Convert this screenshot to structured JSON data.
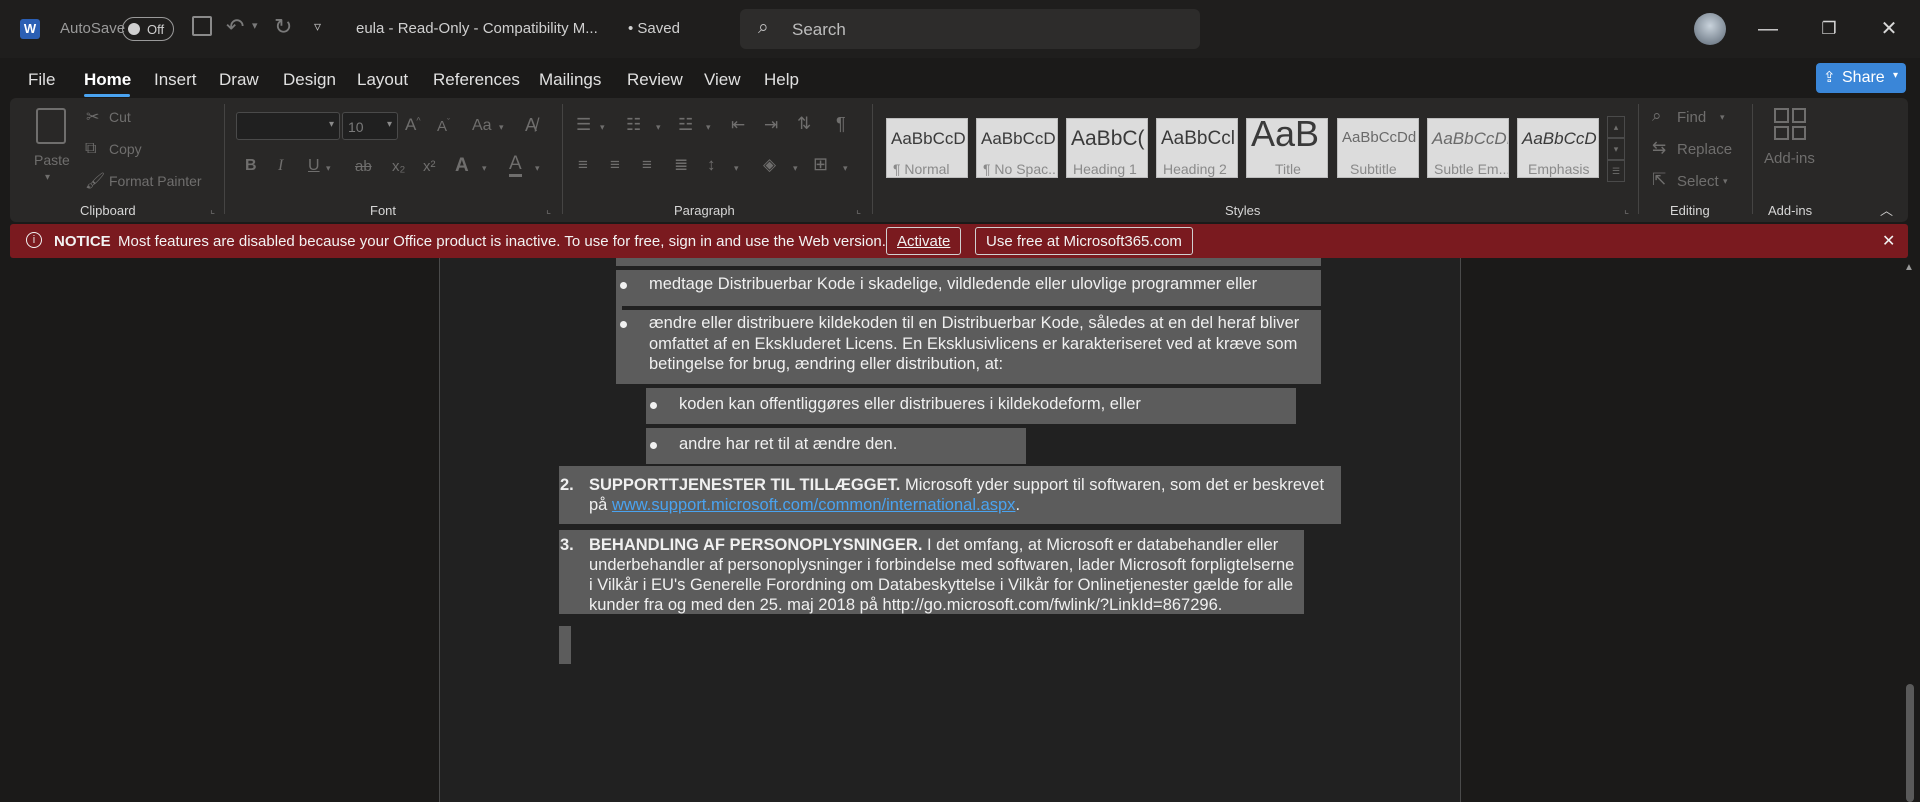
{
  "titlebar": {
    "autosave_label": "AutoSave",
    "autosave_state": "Off",
    "doc_title": "eula  -  Read-Only  -  Compatibility M...",
    "save_status": "• Saved",
    "search_placeholder": "Search"
  },
  "menu": [
    "File",
    "Home",
    "Insert",
    "Draw",
    "Design",
    "Layout",
    "References",
    "Mailings",
    "Review",
    "View",
    "Help"
  ],
  "share_label": "Share",
  "ribbon": {
    "clipboard": {
      "paste": "Paste",
      "cut": "Cut",
      "copy": "Copy",
      "format_painter": "Format Painter",
      "label": "Clipboard"
    },
    "font": {
      "size": "10",
      "label": "Font",
      "bold": "B",
      "italic": "I",
      "underline": "U",
      "strike": "ab",
      "sub": "x₂",
      "sup": "x²",
      "aa": "Aa"
    },
    "paragraph_label": "Paragraph",
    "styles": [
      {
        "preview": "AaBbCcD",
        "name": "¶ Normal"
      },
      {
        "preview": "AaBbCcD",
        "name": "¶ No Spac..."
      },
      {
        "preview": "AaBbC(",
        "name": "Heading 1"
      },
      {
        "preview": "AaBbCcl",
        "name": "Heading 2"
      },
      {
        "preview": "AaB",
        "name": "Title"
      },
      {
        "preview": "AaBbCcDd",
        "name": "Subtitle"
      },
      {
        "preview": "AaBbCcDı",
        "name": "Subtle Em..."
      },
      {
        "preview": "AaBbCcD",
        "name": "Emphasis"
      }
    ],
    "styles_label": "Styles",
    "editing": {
      "find": "Find",
      "replace": "Replace",
      "select": "Select",
      "label": "Editing"
    },
    "addins": {
      "button": "Add-ins",
      "label": "Add-ins"
    }
  },
  "notice": {
    "title": "NOTICE",
    "message": "Most features are disabled because your Office product is inactive. To use for free, sign in and use the Web version.",
    "activate": "Activate",
    "use_free": "Use free at Microsoft365.com"
  },
  "document": {
    "bullet1": "medtage Distribuerbar Kode i skadelige, vildledende eller ulovlige programmer eller",
    "bullet2_l1": "ændre eller distribuere kildekoden til en Distribuerbar Kode, således at en del heraf bliver",
    "bullet2_l2": "omfattet af en Ekskluderet Licens. En Eksklusivlicens er karakteriseret ved at kræve som",
    "bullet2_l3": "betingelse for brug, ændring eller distribution, at:",
    "sub1": "koden kan offentliggøres eller distribueres i kildekodeform, eller",
    "sub2": "andre har ret til at ændre den.",
    "item2_num": "2.",
    "item2_head": "SUPPORTTJENESTER TIL TILLÆGGET.",
    "item2_l1_rest": " Microsoft yder support til softwaren, som det er beskrevet",
    "item2_l2_pre": "på ",
    "item2_link": "www.support.microsoft.com/common/international.aspx",
    "item2_l2_post": ".",
    "item3_num": "3.",
    "item3_head": "BEHANDLING AF PERSONOPLYSNINGER.",
    "item3_l1_rest": " I det omfang, at Microsoft er databehandler eller",
    "item3_l2": "underbehandler af personoplysninger i forbindelse med softwaren, lader Microsoft forpligtelserne",
    "item3_l3": "i Vilkår i EU's Generelle Forordning om Databeskyttelse i Vilkår for Onlinetjenester gælde for alle",
    "item3_l4": "kunder fra og med den 25. maj 2018 på http://go.microsoft.com/fwlink/?LinkId=867296."
  }
}
